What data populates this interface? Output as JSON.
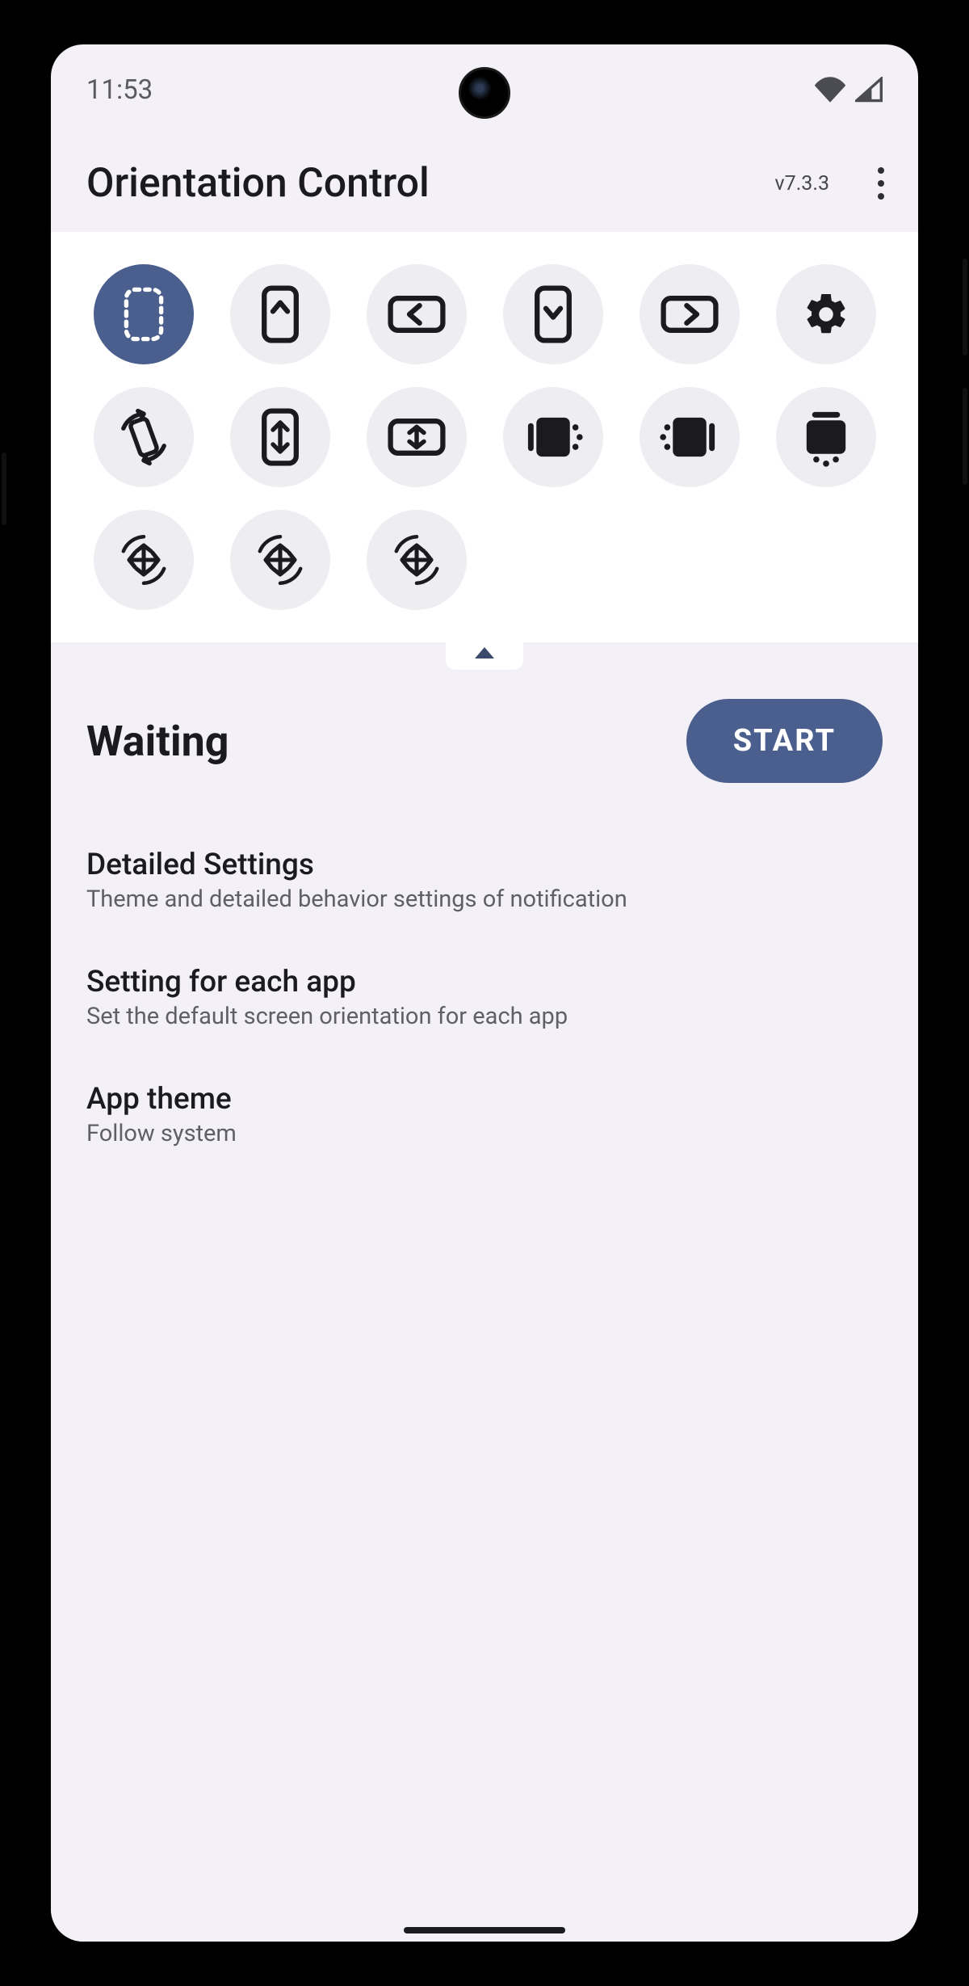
{
  "status_bar": {
    "time": "11:53"
  },
  "app": {
    "title": "Orientation Control",
    "version": "v7.3.3"
  },
  "orientation_buttons": {
    "row0": [
      {
        "name": "unspecified",
        "selected": true
      },
      {
        "name": "portrait",
        "selected": false
      },
      {
        "name": "landscape",
        "selected": false
      },
      {
        "name": "reverse-portrait",
        "selected": false
      },
      {
        "name": "reverse-landscape",
        "selected": false
      },
      {
        "name": "settings",
        "selected": false
      }
    ],
    "row1": [
      {
        "name": "auto-rotate",
        "selected": false
      },
      {
        "name": "sensor-portrait",
        "selected": false
      },
      {
        "name": "sensor-landscape",
        "selected": false
      },
      {
        "name": "force-landscape",
        "selected": false
      },
      {
        "name": "force-reverse-landscape",
        "selected": false
      },
      {
        "name": "force-portrait",
        "selected": false
      }
    ],
    "row2": [
      {
        "name": "full-sensor",
        "selected": false
      },
      {
        "name": "sensor-portrait-any",
        "selected": false
      },
      {
        "name": "sensor-landscape-any",
        "selected": false
      }
    ]
  },
  "status_row": {
    "state": "Waiting",
    "action": "START"
  },
  "list": [
    {
      "title": "Detailed Settings",
      "sub": "Theme and detailed behavior settings of notification"
    },
    {
      "title": "Setting for each app",
      "sub": "Set the default screen orientation for each app"
    },
    {
      "title": "App theme",
      "sub": "Follow system"
    }
  ],
  "colors": {
    "accent": "#4a5f8d",
    "surface": "#f3f1f7",
    "card": "#ffffff",
    "chip": "#eeedf2"
  }
}
